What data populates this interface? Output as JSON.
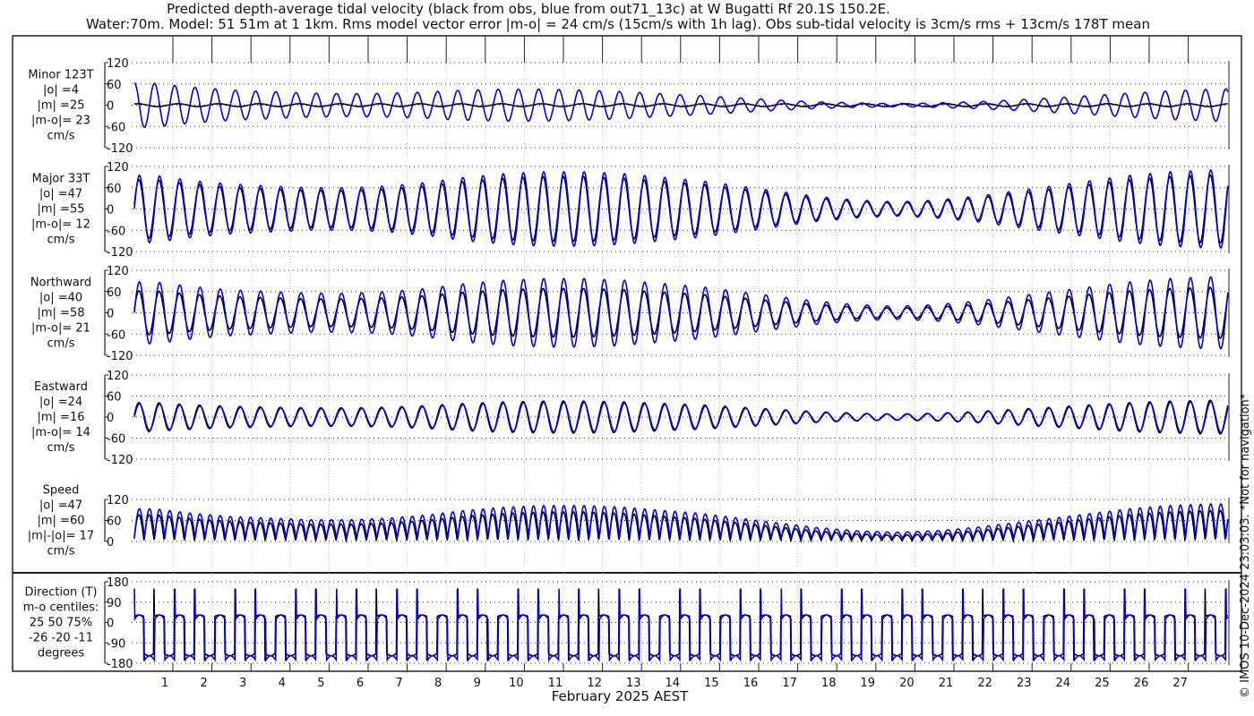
{
  "chart_data": {
    "type": "line",
    "title": "Predicted depth-average tidal velocity (black from obs, blue from out71_13c) at W Bugatti Rf 20.1S 150.2E.",
    "subtitle": "Water:70m. Model: 51 51m at 1 1km. Rms model vector error |m-o| = 24 cm/s (15cm/s with 1h lag). Obs sub-tidal velocity is 3cm/s rms + 13cm/s 178T mean",
    "xlabel": "February 2025 AEST",
    "x_ticks": [
      "1",
      "2",
      "3",
      "4",
      "5",
      "6",
      "7",
      "8",
      "9",
      "10",
      "11",
      "12",
      "13",
      "14",
      "15",
      "16",
      "17",
      "18",
      "19",
      "20",
      "21",
      "22",
      "23",
      "24",
      "25",
      "26",
      "27"
    ],
    "xlim_days": [
      0,
      28
    ],
    "series_legend": [
      {
        "name": "obs",
        "color": "#000000"
      },
      {
        "name": "model out71_13c",
        "color": "#0000ee"
      }
    ],
    "envelope_days": [
      1,
      2,
      3,
      4,
      5,
      6,
      7,
      8,
      9,
      10,
      11,
      12,
      13,
      14,
      15,
      16,
      17,
      18,
      19,
      20,
      21,
      22,
      23,
      24,
      25,
      26,
      27,
      28
    ],
    "major_model_amplitude": [
      95,
      80,
      70,
      65,
      60,
      60,
      65,
      75,
      90,
      100,
      105,
      105,
      100,
      90,
      80,
      65,
      50,
      35,
      25,
      20,
      25,
      35,
      50,
      65,
      80,
      95,
      105,
      110
    ],
    "obs_to_model_ratio": 0.87,
    "panels": [
      {
        "id": "minor",
        "label": [
          "Minor 123T",
          "|o| =4",
          "|m| =25",
          "|m-o|= 23",
          "cm/s"
        ],
        "ylim": [
          -120,
          120
        ],
        "ticks": [
          "120",
          "60",
          "0",
          "-60",
          "-120"
        ],
        "tick_values": [
          120,
          60,
          0,
          -60,
          -120
        ]
      },
      {
        "id": "major",
        "label": [
          "Major 33T",
          "|o| =47",
          "|m| =55",
          "|m-o|= 12",
          "cm/s"
        ],
        "ylim": [
          -120,
          120
        ],
        "ticks": [
          "120",
          "60",
          "0",
          "-60",
          "-120"
        ],
        "tick_values": [
          120,
          60,
          0,
          -60,
          -120
        ]
      },
      {
        "id": "north",
        "label": [
          "Northward",
          "|o| =40",
          "|m| =58",
          "|m-o|= 21",
          "cm/s"
        ],
        "ylim": [
          -120,
          120
        ],
        "ticks": [
          "120",
          "60",
          "0",
          "-60",
          "-120"
        ],
        "tick_values": [
          120,
          60,
          0,
          -60,
          -120
        ]
      },
      {
        "id": "east",
        "label": [
          "Eastward",
          "|o| =24",
          "|m| =16",
          "|m-o|= 14",
          "cm/s"
        ],
        "ylim": [
          -120,
          120
        ],
        "ticks": [
          "120",
          "60",
          "0",
          "-60",
          "-120"
        ],
        "tick_values": [
          120,
          60,
          0,
          -60,
          -120
        ]
      },
      {
        "id": "speed",
        "label": [
          "Speed",
          "|o| =47",
          "|m| =60",
          "|m|-|o|= 17",
          "cm/s"
        ],
        "ylim": [
          0,
          120
        ],
        "ticks": [
          "120",
          "60",
          "0"
        ],
        "tick_values": [
          120,
          60,
          0
        ]
      },
      {
        "id": "direction",
        "label": [
          "Direction (T)",
          "m-o centiles:",
          "25  50  75%",
          "-26 -20 -11",
          "degrees"
        ],
        "ylim": [
          -180,
          180
        ],
        "ticks": [
          "180",
          "90",
          "0",
          "-90",
          "-180"
        ],
        "tick_values": [
          180,
          90,
          0,
          -90,
          -180
        ]
      }
    ]
  },
  "footer": {
    "copyright": "© IMOS 10-Dec-2024 23:03:03.  *Not for navigation*"
  }
}
